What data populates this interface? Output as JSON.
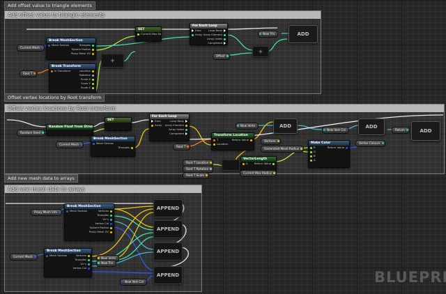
{
  "tabs": {
    "offset": "Add offset value to triangle elements",
    "vertex": "Offset vertex locations by Root transform",
    "arrays": "Add new mesh data to arrays"
  },
  "comments": {
    "offset": "Add offset value to triangle elements",
    "vertex": "Offset vertex locations by Root transform",
    "arrays": "Add new mesh data to arrays"
  },
  "section1": {
    "current_mesh": "Current Mesh",
    "break_mesh_section": {
      "title": "Break MeshSection",
      "inputs": [
        "Mesh Section"
      ],
      "outputs": [
        "Triangles",
        "Sphere Radius",
        "Proxy Mesh UV"
      ]
    },
    "break_transform": {
      "title": "Break Transform",
      "inputs": [
        "In Transform"
      ],
      "outputs": [
        "Location",
        "Rotation",
        "Scale X",
        "Scale Y",
        "Scale Z"
      ]
    },
    "root_t": "Root T",
    "plus_node": "+",
    "set_node": {
      "title": "SET",
      "pins": [
        "Current Max Radius"
      ]
    },
    "for_each_loop": {
      "title": "For Each Loop",
      "left": [
        "Exec",
        "Array"
      ],
      "right": [
        "Loop Body",
        "Array Element",
        "Array Index",
        "Completed"
      ]
    },
    "offset": "Offset",
    "plus2": "+",
    "new_tris": "New Tris",
    "add_label": "ADD"
  },
  "section2": {
    "random_float": "Random Float from Stream",
    "random_seed": "Random Seed",
    "set_node": "SET",
    "current_mesh": "Current Mesh",
    "break_mesh_section": {
      "title": "Break MeshSection",
      "pins": [
        "Mesh Section",
        "Triangles"
      ]
    },
    "for_each_loop": {
      "title": "For Each Loop",
      "left": [
        "Exec",
        "Array"
      ],
      "right": [
        "Loop Body",
        "Array Element",
        "Array Index",
        "Completed"
      ]
    },
    "root_t": "Root T",
    "transform_location": {
      "title": "Transform Location",
      "pins": [
        "T",
        "Location",
        "Return Value"
      ]
    },
    "root_t_location": "Root T Location",
    "root_t_rotation": "Root T Rotation",
    "root_t_scale": "Root T Scale",
    "vector_length": {
      "title": "VectorLength",
      "pins": [
        "A",
        "Return Value"
      ]
    },
    "current_max_radius": "Current Max Radius",
    "new_verts_top": "New Verts",
    "vertices": "Vertices",
    "generated_mesh": "Generated Mesh Radius",
    "make_color": {
      "title": "Make Color",
      "pins": [
        "R",
        "G",
        "B",
        "A",
        "Return Value"
      ]
    },
    "new_vert_col": "New Vert Col",
    "vertex_colours": "Vertex Colours",
    "return": "Return",
    "add_label": "ADD"
  },
  "section3": {
    "proxy_mesh_info": "Proxy Mesh Info",
    "current_mesh": "Current Mesh",
    "break_mesh_section_1": {
      "title": "Break MeshSection",
      "left": [
        "Mesh Section"
      ],
      "right": [
        "Vertices",
        "Triangles",
        "UV s",
        "Vertex Col",
        "Sphere Radius",
        "Proxy Mesh UV"
      ]
    },
    "break_mesh_section_2": {
      "title": "Break MeshSection",
      "left": [
        "Mesh Section"
      ],
      "right": [
        "Vertices",
        "Triangles",
        "UV s",
        "Vertex Col"
      ]
    },
    "new_verts": "New Verts",
    "new_tris": "New Tris",
    "new_vert_col": "New Vert Col",
    "append_label": "APPEND"
  },
  "watermark": "BLUEPRINT",
  "colors": {
    "exec": "#ffffff",
    "struct": "#2f5fd0",
    "int": "#38e0a8",
    "float": "#a8e838",
    "vector": "#f0c000",
    "transform": "#f07020",
    "color": "#2050f0",
    "array": "#36b6c8"
  }
}
